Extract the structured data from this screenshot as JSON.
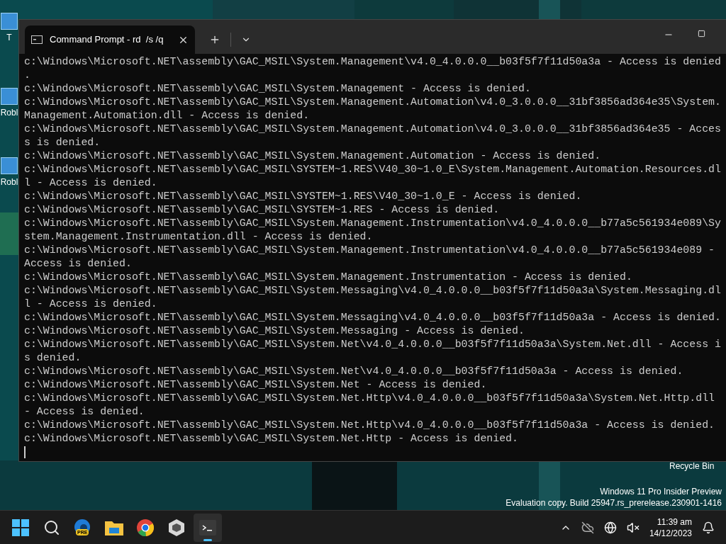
{
  "desktop": {
    "icons": [
      {
        "label": "T"
      },
      {
        "label": "Robl"
      },
      {
        "label": "Robl"
      }
    ],
    "recycle_bin": {
      "label": "Recycle Bin"
    },
    "evaluation_notice": [
      "Windows 11 Pro Insider Preview",
      "Evaluation copy. Build 25947.rs_prerelease.230901-1416"
    ]
  },
  "terminal": {
    "tab": {
      "title": "Command Prompt - rd  /s /q",
      "selected": true
    },
    "lines": [
      "c:\\Windows\\Microsoft.NET\\assembly\\GAC_MSIL\\System.Management\\v4.0_4.0.0.0__b03f5f7f11d50a3a - Access is denied",
      ".",
      "c:\\Windows\\Microsoft.NET\\assembly\\GAC_MSIL\\System.Management - Access is denied.",
      "c:\\Windows\\Microsoft.NET\\assembly\\GAC_MSIL\\System.Management.Automation\\v4.0_3.0.0.0__31bf3856ad364e35\\System.",
      "Management.Automation.dll - Access is denied.",
      "c:\\Windows\\Microsoft.NET\\assembly\\GAC_MSIL\\System.Management.Automation\\v4.0_3.0.0.0__31bf3856ad364e35 - Acces",
      "s is denied.",
      "c:\\Windows\\Microsoft.NET\\assembly\\GAC_MSIL\\System.Management.Automation - Access is denied.",
      "c:\\Windows\\Microsoft.NET\\assembly\\GAC_MSIL\\SYSTEM~1.RES\\V40_30~1.0_E\\System.Management.Automation.Resources.dl",
      "l - Access is denied.",
      "c:\\Windows\\Microsoft.NET\\assembly\\GAC_MSIL\\SYSTEM~1.RES\\V40_30~1.0_E - Access is denied.",
      "c:\\Windows\\Microsoft.NET\\assembly\\GAC_MSIL\\SYSTEM~1.RES - Access is denied.",
      "c:\\Windows\\Microsoft.NET\\assembly\\GAC_MSIL\\System.Management.Instrumentation\\v4.0_4.0.0.0__b77a5c561934e089\\Sy",
      "stem.Management.Instrumentation.dll - Access is denied.",
      "c:\\Windows\\Microsoft.NET\\assembly\\GAC_MSIL\\System.Management.Instrumentation\\v4.0_4.0.0.0__b77a5c561934e089 -",
      "Access is denied.",
      "c:\\Windows\\Microsoft.NET\\assembly\\GAC_MSIL\\System.Management.Instrumentation - Access is denied.",
      "c:\\Windows\\Microsoft.NET\\assembly\\GAC_MSIL\\System.Messaging\\v4.0_4.0.0.0__b03f5f7f11d50a3a\\System.Messaging.dl",
      "l - Access is denied.",
      "c:\\Windows\\Microsoft.NET\\assembly\\GAC_MSIL\\System.Messaging\\v4.0_4.0.0.0__b03f5f7f11d50a3a - Access is denied.",
      "c:\\Windows\\Microsoft.NET\\assembly\\GAC_MSIL\\System.Messaging - Access is denied.",
      "c:\\Windows\\Microsoft.NET\\assembly\\GAC_MSIL\\System.Net\\v4.0_4.0.0.0__b03f5f7f11d50a3a\\System.Net.dll - Access i",
      "s denied.",
      "c:\\Windows\\Microsoft.NET\\assembly\\GAC_MSIL\\System.Net\\v4.0_4.0.0.0__b03f5f7f11d50a3a - Access is denied.",
      "c:\\Windows\\Microsoft.NET\\assembly\\GAC_MSIL\\System.Net - Access is denied.",
      "c:\\Windows\\Microsoft.NET\\assembly\\GAC_MSIL\\System.Net.Http\\v4.0_4.0.0.0__b03f5f7f11d50a3a\\System.Net.Http.dll",
      "- Access is denied.",
      "c:\\Windows\\Microsoft.NET\\assembly\\GAC_MSIL\\System.Net.Http\\v4.0_4.0.0.0__b03f5f7f11d50a3a - Access is denied.",
      "c:\\Windows\\Microsoft.NET\\assembly\\GAC_MSIL\\System.Net.Http - Access is denied."
    ]
  },
  "taskbar": {
    "apps": [
      {
        "kind": "start",
        "selected": false
      },
      {
        "kind": "search",
        "selected": false
      },
      {
        "kind": "edge",
        "badge": "PRE",
        "selected": false
      },
      {
        "kind": "explorer",
        "selected": false
      },
      {
        "kind": "chrome",
        "selected": false
      },
      {
        "kind": "cube",
        "selected": false
      },
      {
        "kind": "terminal",
        "selected": true
      }
    ],
    "tray": {
      "time": "11:39 am",
      "date": "14/12/2023"
    }
  }
}
